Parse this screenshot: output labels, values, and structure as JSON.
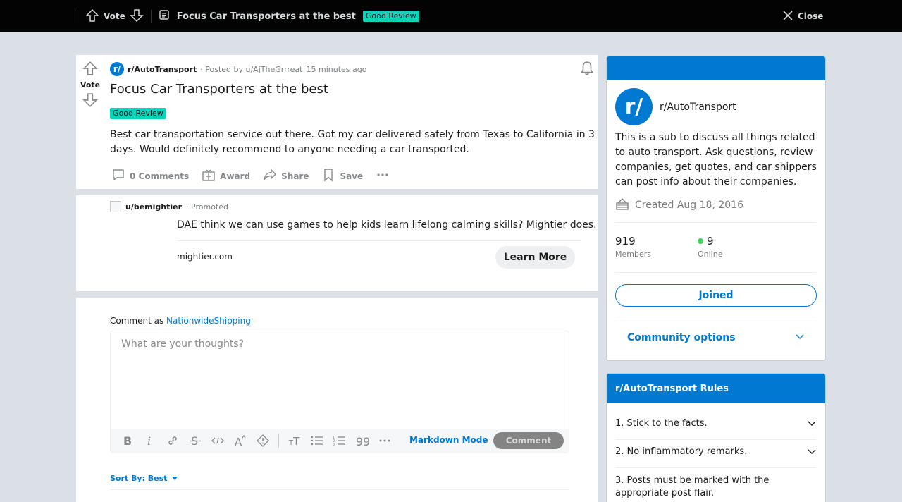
{
  "topbar": {
    "vote_label": "Vote",
    "post_title": "Focus Car Transporters at the best",
    "flair": "Good Review",
    "close_label": "Close"
  },
  "post": {
    "vote_label": "Vote",
    "subreddit": "r/AutoTransport",
    "posted_by": "· Posted by u/AjTheGrrreat",
    "time": "15 minutes ago",
    "title": "Focus Car Transporters at the best",
    "flair": "Good Review",
    "body": "Best car transportation service out there. Got my car delivered safely from Texas to California in 3 days. Would definitely recommend to anyone needing a car transported.",
    "actions": {
      "comments": "0 Comments",
      "award": "Award",
      "share": "Share",
      "save": "Save"
    }
  },
  "promoted": {
    "user": "u/bemightier",
    "tag": "· Promoted",
    "text": "DAE think we can use games to help kids learn lifelong calming skills? Mightier does.",
    "domain": "mightier.com",
    "cta": "Learn More"
  },
  "comment_box": {
    "comment_as": "Comment as",
    "username": "NationwideShipping",
    "placeholder": "What are your thoughts?",
    "markdown_mode": "Markdown Mode",
    "submit": "Comment",
    "sort_by": "Sort By: Best"
  },
  "about": {
    "subreddit": "r/AutoTransport",
    "avatar_text": "r/",
    "description": "This is a sub to discuss all things related to auto transport. Ask questions, review companies, get quotes, and car shippers can post info about their companies.",
    "created": "Created Aug 18, 2016",
    "members_count": "919",
    "members_label": "Members",
    "online_count": "9",
    "online_label": "Online",
    "joined": "Joined",
    "community_options": "Community options"
  },
  "rules": {
    "title": "r/AutoTransport Rules",
    "items": [
      {
        "label": "1. Stick to the facts."
      },
      {
        "label": "2. No inflammatory remarks."
      },
      {
        "label": "3. Posts must be marked with the appropriate post flair."
      }
    ]
  },
  "colors": {
    "accent": "#0079d3",
    "flair": "#0dd3bb",
    "online": "#46d160"
  }
}
